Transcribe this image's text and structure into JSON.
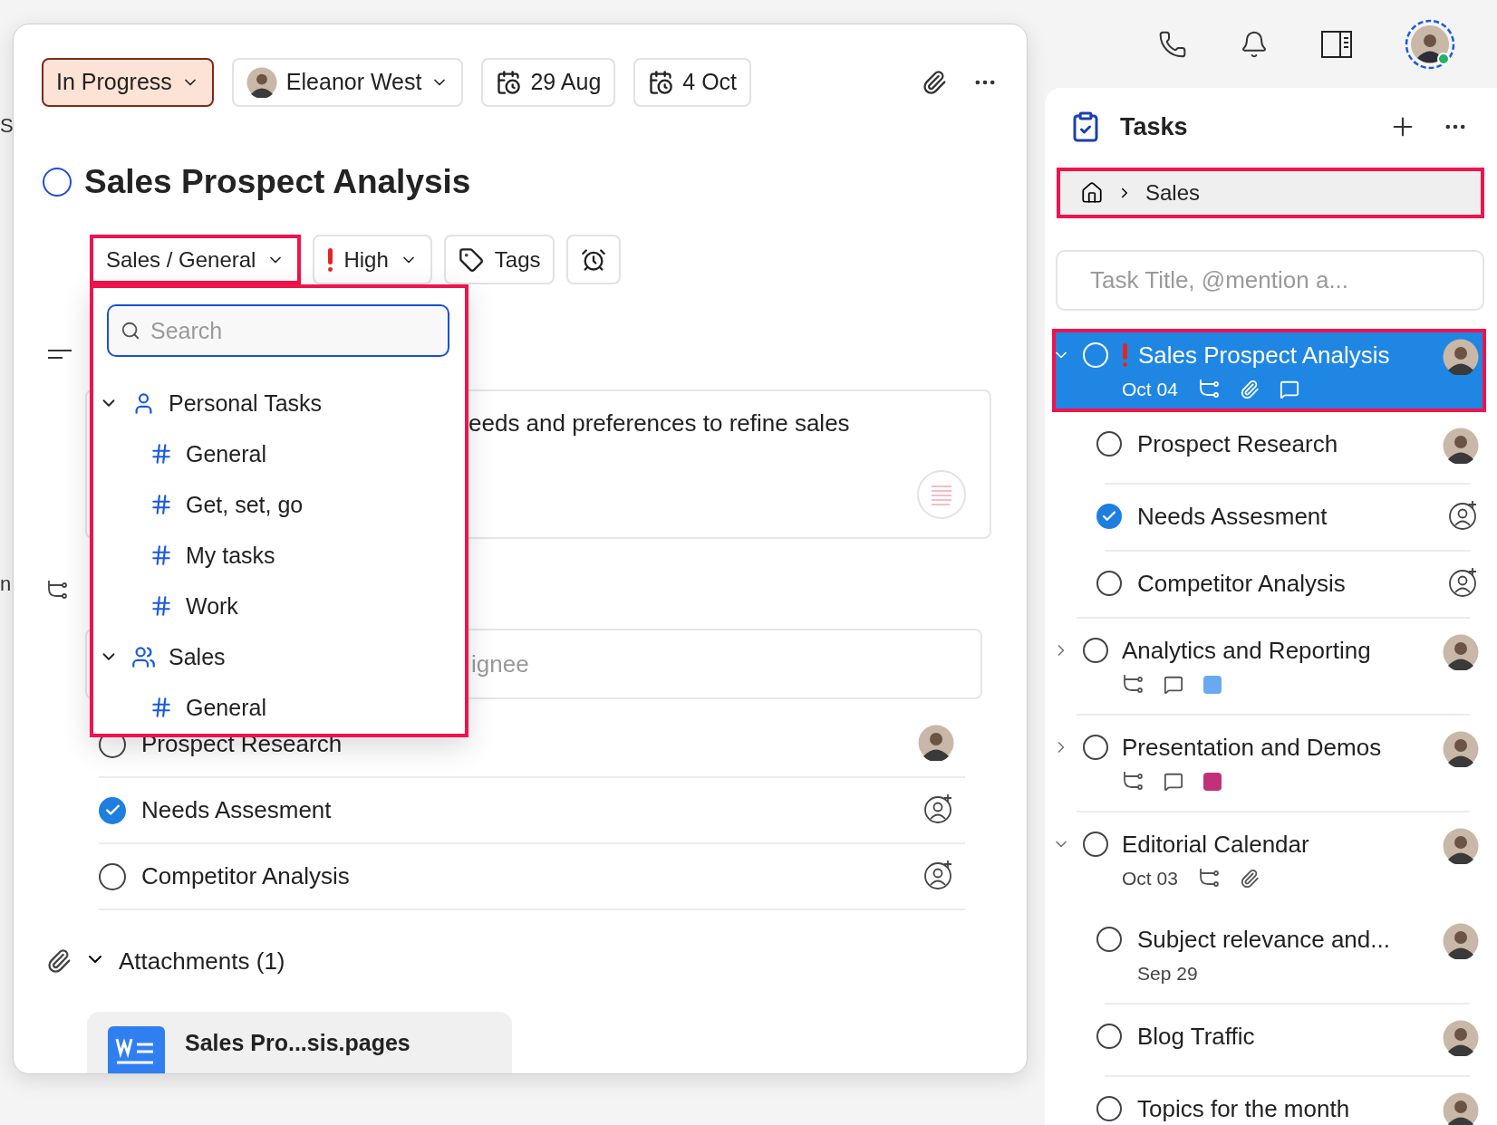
{
  "background": {
    "fragments": [
      "S",
      "n"
    ]
  },
  "task_panel": {
    "status": {
      "label": "In Progress"
    },
    "assignee": {
      "name": "Eleanor West"
    },
    "start_date": "29 Aug",
    "due_date": "4 Oct",
    "title": "Sales Prospect Analysis",
    "completed": false,
    "chips": [
      {
        "kind": "project",
        "label": "Sales / General",
        "highlighted": true
      },
      {
        "kind": "priority",
        "label": "High",
        "highlighted": false
      },
      {
        "kind": "tags",
        "label": "Tags",
        "highlighted": false
      },
      {
        "kind": "reminder",
        "highlighted": false
      }
    ],
    "description": "eeds and preferences to refine sales",
    "assignee_field": {
      "placeholder": "ignee"
    },
    "subtasks": [
      {
        "title": "Prospect Research",
        "checked": false,
        "assigned": true
      },
      {
        "title": "Needs Assesment",
        "checked": true,
        "assigned": false
      },
      {
        "title": "Competitor Analysis",
        "checked": false,
        "assigned": false
      }
    ],
    "attachments": {
      "label": "Attachments (1)",
      "expanded": true,
      "files": [
        "Sales Pro...sis.pages"
      ]
    }
  },
  "project_menu": {
    "highlighted": true,
    "search": {
      "placeholder": "Search"
    },
    "groups": [
      {
        "name": "Personal Tasks",
        "kind": "personal",
        "expanded": true,
        "children": [
          {
            "label": "General"
          },
          {
            "label": "Get, set, go"
          },
          {
            "label": "My tasks"
          },
          {
            "label": "Work"
          }
        ]
      },
      {
        "name": "Sales",
        "kind": "team",
        "expanded": true,
        "children": [
          {
            "label": "General"
          }
        ]
      }
    ]
  },
  "sidebar": {
    "title": "Tasks",
    "breadcrumb": {
      "items": [
        "Sales"
      ],
      "highlighted": true
    },
    "new_task": {
      "placeholder": "Task Title, @mention a..."
    },
    "tasks": [
      {
        "title": "Sales Prospect Analysis",
        "checked": false,
        "selected": true,
        "highlighted": true,
        "high_priority": true,
        "assigned": true,
        "expanded": true,
        "date": "Oct 04",
        "has_subtasks": true,
        "has_attachment": true,
        "has_comments": true,
        "children": [
          {
            "title": "Prospect Research",
            "checked": false,
            "selected": false,
            "assigned": true
          },
          {
            "title": "Needs Assesment",
            "checked": true,
            "selected": false,
            "assigned": false
          },
          {
            "title": "Competitor Analysis",
            "checked": false,
            "selected": false,
            "assigned": false
          }
        ]
      },
      {
        "title": "Analytics and Reporting",
        "checked": false,
        "selected": false,
        "assigned": true,
        "expanded": false,
        "has_subtasks": true,
        "has_comments": true,
        "color": "#6aa9f0"
      },
      {
        "title": "Presentation and Demos",
        "checked": false,
        "selected": false,
        "assigned": true,
        "expanded": false,
        "has_subtasks": true,
        "has_comments": true,
        "color": "#c2307a"
      },
      {
        "title": "Editorial Calendar",
        "checked": false,
        "selected": false,
        "assigned": true,
        "expanded": true,
        "date": "Oct 03",
        "has_subtasks": true,
        "has_attachment": true,
        "children": [
          {
            "title": "Subject relevance and...",
            "checked": false,
            "selected": false,
            "assigned": true,
            "date": "Sep 29"
          },
          {
            "title": "Blog Traffic",
            "checked": false,
            "selected": false,
            "assigned": true
          },
          {
            "title": "Topics for the month",
            "checked": false,
            "selected": false,
            "assigned": true
          }
        ]
      }
    ]
  }
}
